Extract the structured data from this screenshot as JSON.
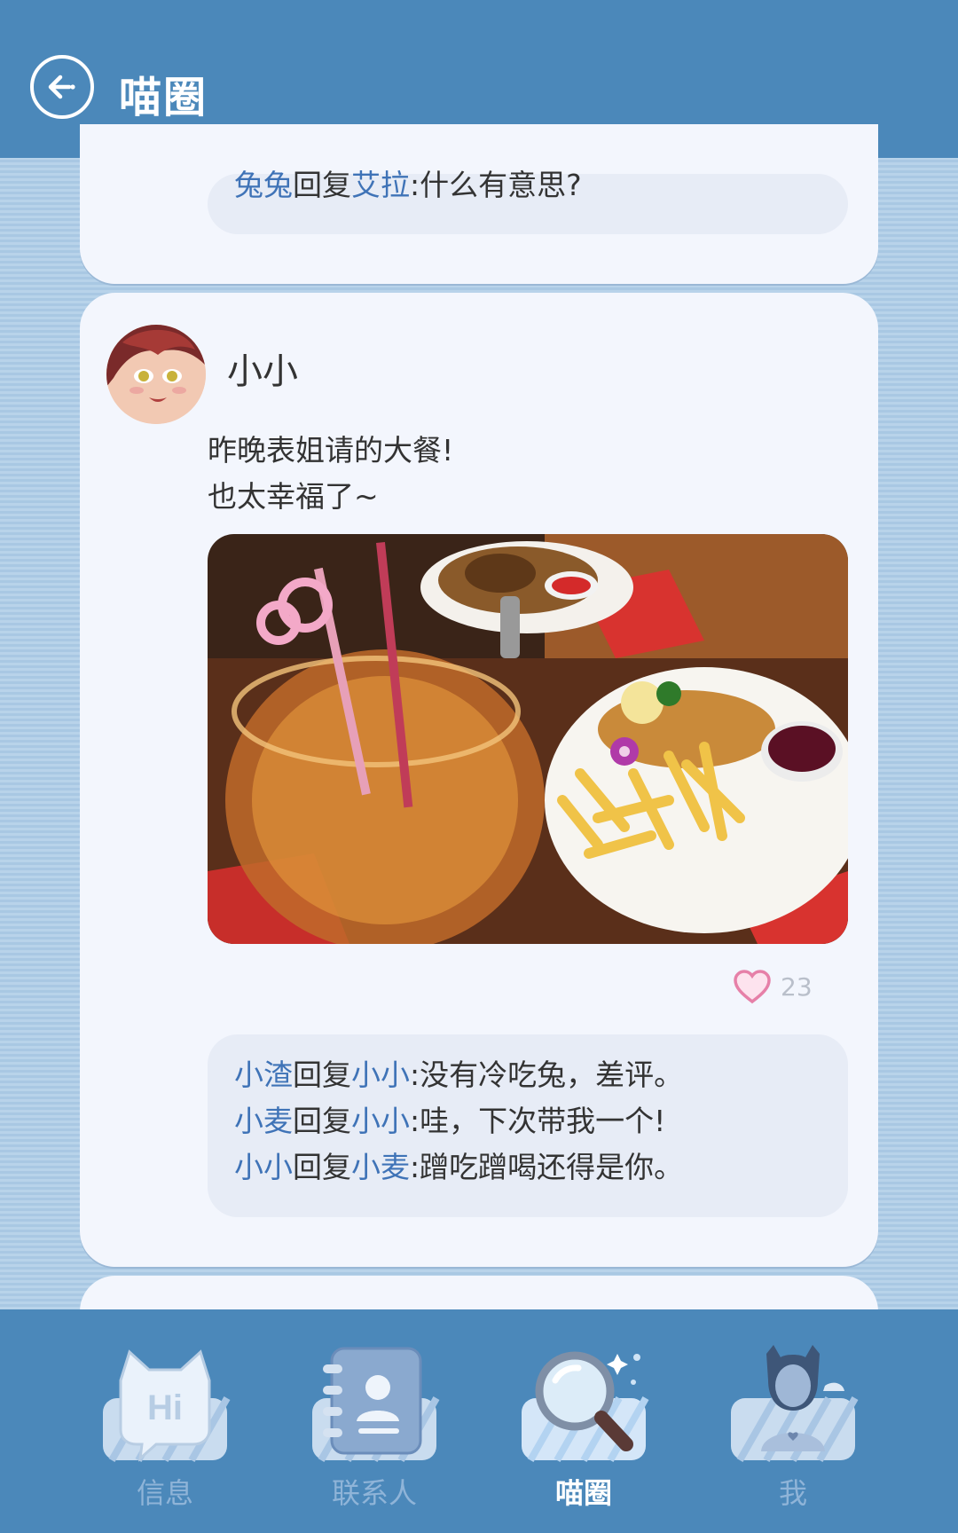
{
  "header": {
    "title": "喵圈"
  },
  "prev_post": {
    "replies": [
      {
        "from": "兔兔",
        "mid": "回复",
        "to": "艾拉",
        "text": ":什么有意思?"
      }
    ]
  },
  "post": {
    "username": "小小",
    "text_lines": [
      "昨晚表姐请的大餐!",
      "也太幸福了~"
    ],
    "likes": "23",
    "replies": [
      {
        "from": "小渣",
        "mid": "回复",
        "to": "小小",
        "text": ":没有冷吃兔，差评。"
      },
      {
        "from": "小麦",
        "mid": "回复",
        "to": "小小",
        "text": ":哇，下次带我一个!"
      },
      {
        "from": "小小",
        "mid": "回复",
        "to": "小麦",
        "text": ":蹭吃蹭喝还得是你。"
      }
    ]
  },
  "nav": {
    "items": [
      {
        "label": "信息",
        "icon": "hi-cat-icon"
      },
      {
        "label": "联系人",
        "icon": "contacts-book-icon"
      },
      {
        "label": "喵圈",
        "icon": "magnifier-icon",
        "active": true
      },
      {
        "label": "我",
        "icon": "user-avatar-icon"
      }
    ],
    "hi_text": "Hi"
  },
  "colors": {
    "header": "#4b88ba",
    "link": "#3f73b7",
    "card": "#f3f6fd",
    "heart": "#e680a8"
  }
}
